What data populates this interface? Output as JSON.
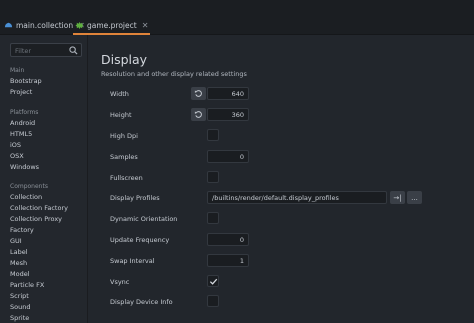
{
  "tabs": [
    {
      "label": "main.collection",
      "icon": "collection-icon",
      "close": "✕"
    },
    {
      "label": "game.project",
      "icon": "project-icon",
      "close": "✕",
      "active": true
    }
  ],
  "sidebar": {
    "filter_placeholder": "Filter",
    "groups": [
      {
        "label": "Main",
        "items": [
          "Bootstrap",
          "Project"
        ]
      },
      {
        "label": "Platforms",
        "items": [
          "Android",
          "HTML5",
          "iOS",
          "OSX",
          "Windows"
        ]
      },
      {
        "label": "Components",
        "items": [
          "Collection",
          "Collection Factory",
          "Collection Proxy",
          "Factory",
          "GUI",
          "Label",
          "Mesh",
          "Model",
          "Particle FX",
          "Script",
          "Sound",
          "Sprite"
        ]
      }
    ]
  },
  "section": {
    "title": "Display",
    "subtitle": "Resolution and other display related settings"
  },
  "fields": {
    "width": {
      "label": "Width",
      "value": "640"
    },
    "height": {
      "label": "Height",
      "value": "360"
    },
    "high_dpi": {
      "label": "High Dpi",
      "checked": false
    },
    "samples": {
      "label": "Samples",
      "value": "0"
    },
    "fullscreen": {
      "label": "Fullscreen",
      "checked": false
    },
    "display_profiles": {
      "label": "Display Profiles",
      "value": "/builtins/render/default.display_profiles",
      "goto_label": "→|",
      "browse_label": "..."
    },
    "dynamic_orientation": {
      "label": "Dynamic Orientation",
      "checked": false
    },
    "update_frequency": {
      "label": "Update Frequency",
      "value": "0"
    },
    "swap_interval": {
      "label": "Swap Interval",
      "value": "1"
    },
    "vsync": {
      "label": "Vsync",
      "checked": true
    },
    "display_device_info": {
      "label": "Display Device Info",
      "checked": false
    }
  },
  "colors": {
    "accent": "#e0843a",
    "background": "#22262c",
    "tab_bar": "#1b1e22"
  }
}
